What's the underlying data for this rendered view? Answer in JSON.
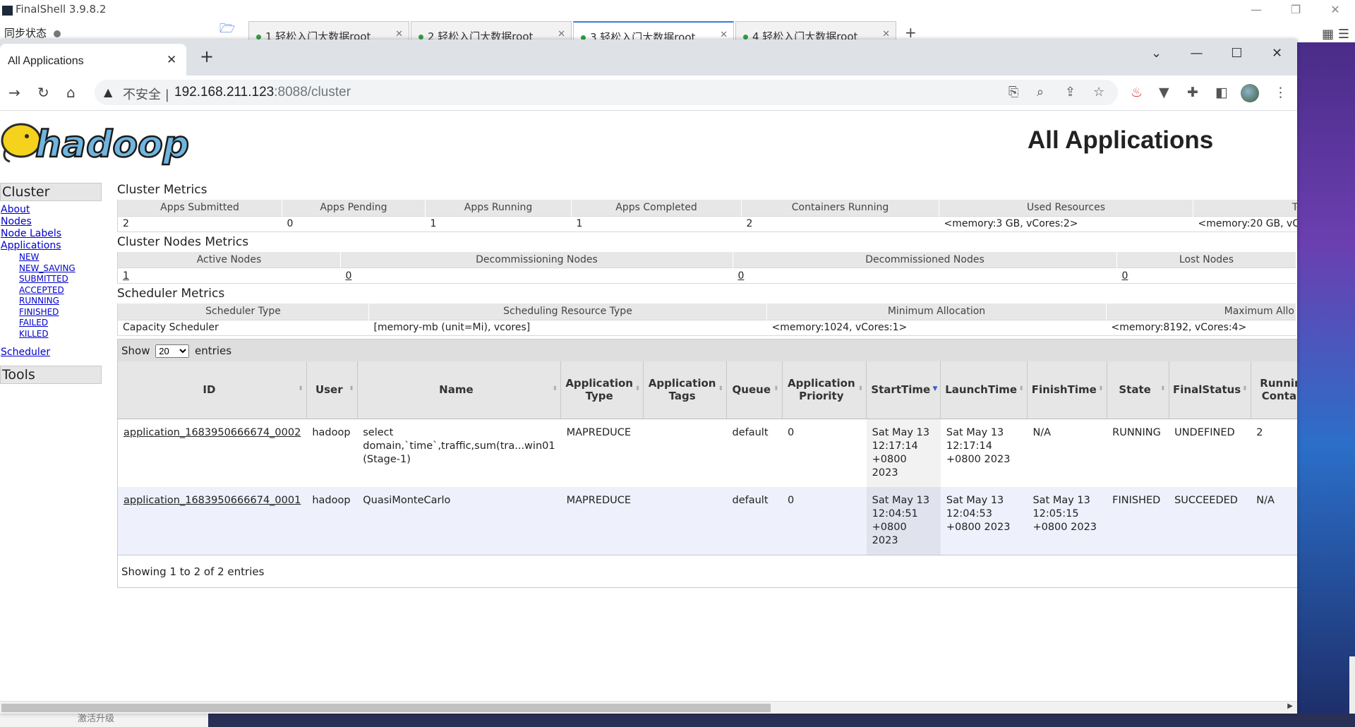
{
  "finalshell": {
    "title": "FinalShell 3.9.8.2",
    "sync_status": "同步状态",
    "tabs": [
      {
        "label": "1 轻松入门大数据root"
      },
      {
        "label": "2 轻松入门大数据root"
      },
      {
        "label": "3 轻松入门大数据root"
      },
      {
        "label": "4 轻松入门大数据root"
      }
    ],
    "bottom_text": "激活升级"
  },
  "browser": {
    "tab_title": "All Applications",
    "security_label": "不安全",
    "url_host": "192.168.211.123",
    "url_path": ":8088/cluster"
  },
  "page": {
    "title": "All Applications",
    "sidebar": {
      "cluster_head": "Cluster",
      "links": [
        "About",
        "Nodes",
        "Node Labels",
        "Applications"
      ],
      "app_states": [
        "NEW",
        "NEW_SAVING",
        "SUBMITTED",
        "ACCEPTED",
        "RUNNING",
        "FINISHED",
        "FAILED",
        "KILLED"
      ],
      "scheduler_link": "Scheduler",
      "tools_head": "Tools"
    },
    "cluster_metrics": {
      "title": "Cluster Metrics",
      "headers": [
        "Apps Submitted",
        "Apps Pending",
        "Apps Running",
        "Apps Completed",
        "Containers Running",
        "Used Resources",
        "To"
      ],
      "values": [
        "2",
        "0",
        "1",
        "1",
        "2",
        "<memory:3 GB, vCores:2>",
        "<memory:20 GB, vC"
      ]
    },
    "node_metrics": {
      "title": "Cluster Nodes Metrics",
      "headers": [
        "Active Nodes",
        "Decommissioning Nodes",
        "Decommissioned Nodes",
        "Lost Nodes"
      ],
      "values": [
        "1",
        "0",
        "0",
        "0"
      ]
    },
    "scheduler_metrics": {
      "title": "Scheduler Metrics",
      "headers": [
        "Scheduler Type",
        "Scheduling Resource Type",
        "Minimum Allocation",
        "Maximum Allo"
      ],
      "values": [
        "Capacity Scheduler",
        "[memory-mb (unit=Mi), vcores]",
        "<memory:1024, vCores:1>",
        "<memory:8192, vCores:4>"
      ]
    },
    "apps_table": {
      "show_label": "Show",
      "entries_value": "20",
      "entries_label": "entries",
      "headers": [
        "ID",
        "User",
        "Name",
        "Application Type",
        "Application Tags",
        "Queue",
        "Application Priority",
        "StartTime",
        "LaunchTime",
        "FinishTime",
        "State",
        "FinalStatus",
        "Running Contain"
      ],
      "rows": [
        {
          "id": "application_1683950666674_0002",
          "user": "hadoop",
          "name": "select domain,`time`,traffic,sum(tra...win01 (Stage-1)",
          "type": "MAPREDUCE",
          "tags": "",
          "queue": "default",
          "priority": "0",
          "start": "Sat May 13 12:17:14 +0800 2023",
          "launch": "Sat May 13 12:17:14 +0800 2023",
          "finish": "N/A",
          "state": "RUNNING",
          "final_status": "UNDEFINED",
          "running": "2"
        },
        {
          "id": "application_1683950666674_0001",
          "user": "hadoop",
          "name": "QuasiMonteCarlo",
          "type": "MAPREDUCE",
          "tags": "",
          "queue": "default",
          "priority": "0",
          "start": "Sat May 13 12:04:51 +0800 2023",
          "launch": "Sat May 13 12:04:53 +0800 2023",
          "finish": "Sat May 13 12:05:15 +0800 2023",
          "state": "FINISHED",
          "final_status": "SUCCEEDED",
          "running": "N/A"
        }
      ],
      "footer": "Showing 1 to 2 of 2 entries"
    },
    "logo_text": "hadoop"
  }
}
